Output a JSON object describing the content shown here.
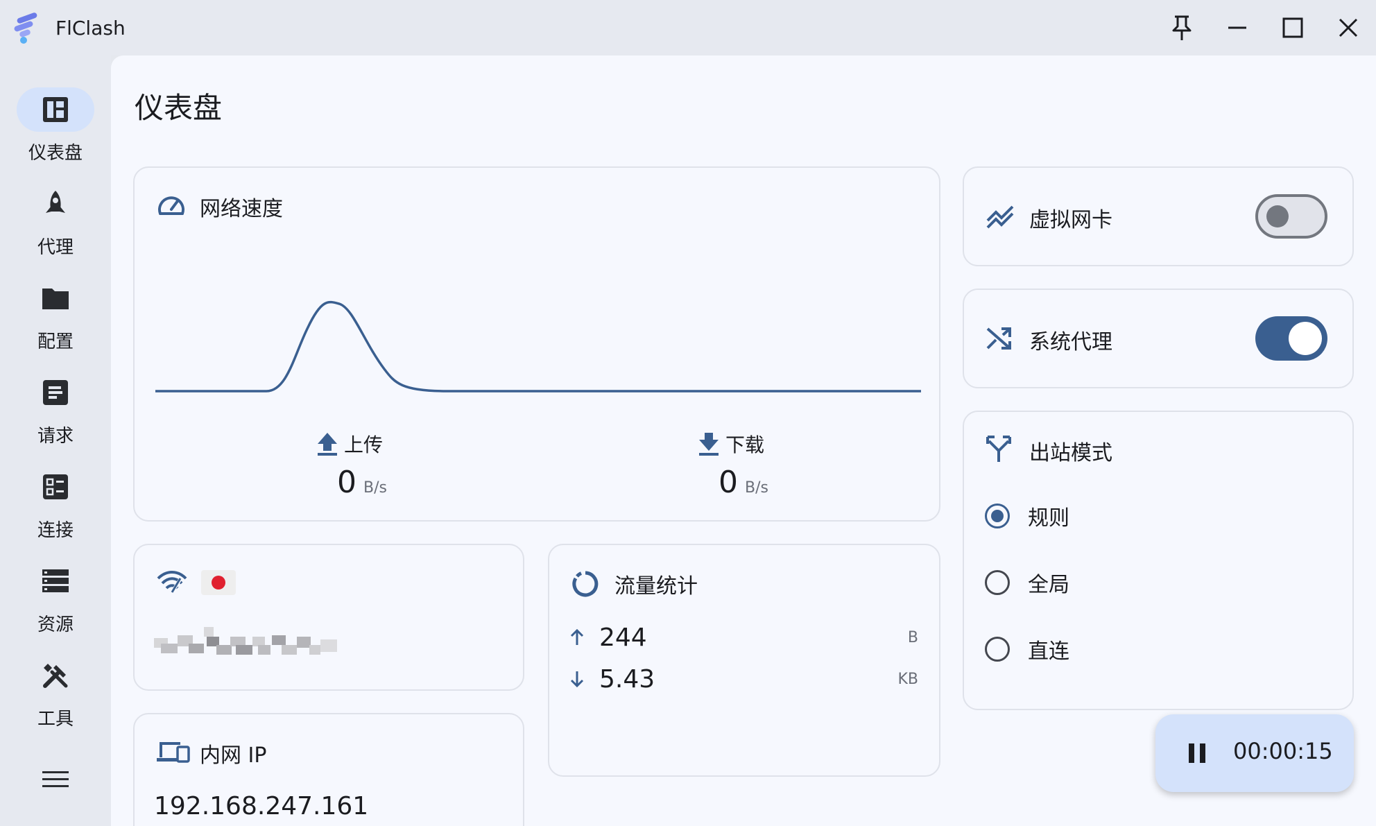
{
  "window": {
    "title": "FlClash"
  },
  "nav": {
    "items": [
      {
        "label": "仪表盘",
        "icon": "dashboard-icon",
        "active": true
      },
      {
        "label": "代理",
        "icon": "rocket-icon"
      },
      {
        "label": "配置",
        "icon": "folder-icon"
      },
      {
        "label": "请求",
        "icon": "request-icon"
      },
      {
        "label": "连接",
        "icon": "connection-icon"
      },
      {
        "label": "资源",
        "icon": "storage-icon"
      },
      {
        "label": "工具",
        "icon": "tools-icon"
      }
    ]
  },
  "page": {
    "title": "仪表盘"
  },
  "speed": {
    "title": "网络速度",
    "upload_label": "上传",
    "upload_value": "0",
    "upload_unit": "B/s",
    "download_label": "下载",
    "download_value": "0",
    "download_unit": "B/s"
  },
  "tun": {
    "title": "虚拟网卡",
    "enabled": false
  },
  "system_proxy": {
    "title": "系统代理",
    "enabled": true
  },
  "outbound_mode": {
    "title": "出站模式",
    "options": [
      {
        "label": "规则",
        "selected": true
      },
      {
        "label": "全局",
        "selected": false
      },
      {
        "label": "直连",
        "selected": false
      }
    ]
  },
  "network": {
    "flag": "JP"
  },
  "traffic": {
    "title": "流量统计",
    "up_value": "244",
    "up_unit": "B",
    "down_value": "5.43",
    "down_unit": "KB"
  },
  "lan": {
    "title": "内网 IP",
    "ip": "192.168.247.161"
  },
  "timer": {
    "elapsed": "00:00:15"
  },
  "colors": {
    "accent": "#3a5f90",
    "nav_active": "#d4e2fb",
    "surface": "#f6f8fe",
    "chrome": "#e6e9f0"
  }
}
